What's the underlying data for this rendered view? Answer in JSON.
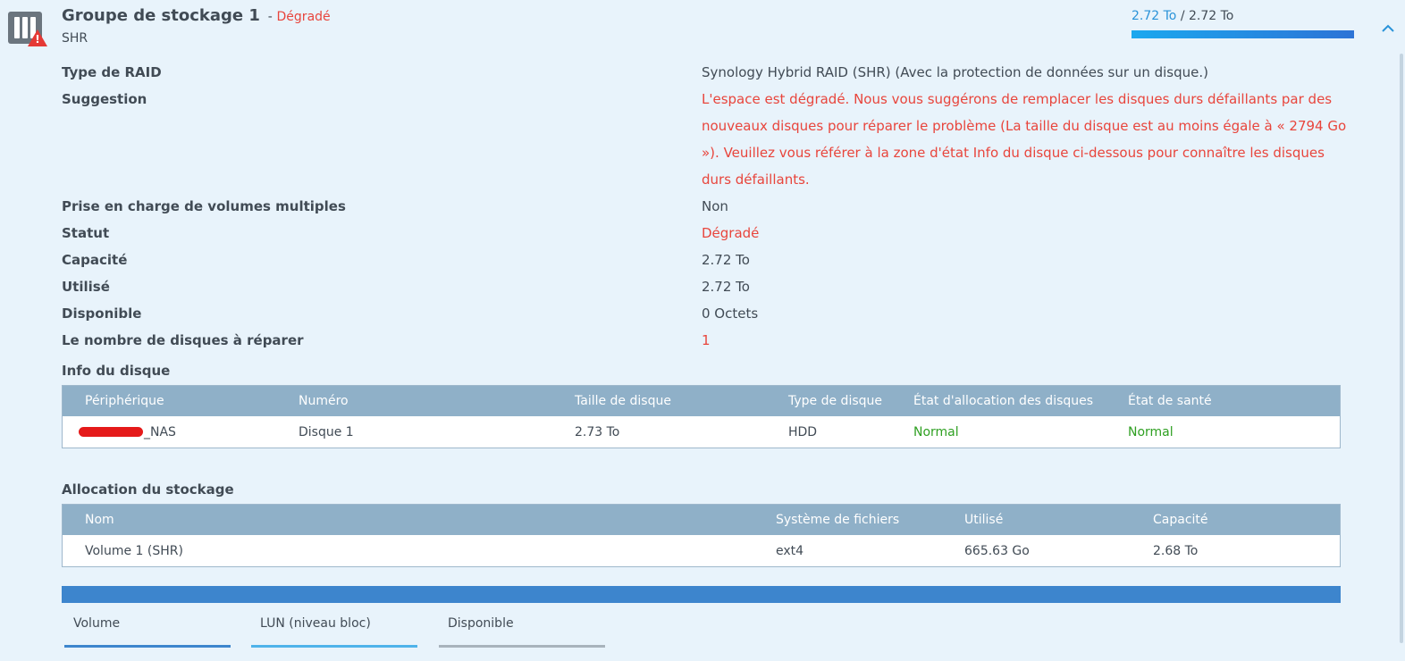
{
  "pool": {
    "title": "Groupe de stockage 1",
    "separator": "-",
    "status": "Dégradé",
    "subtitle": "SHR",
    "usage_used": "2.72 To",
    "usage_sep": " / ",
    "usage_total": "2.72 To",
    "usage_fraction": 1.0
  },
  "info": [
    {
      "label": "Type de RAID",
      "value": "Synology Hybrid RAID (SHR) (Avec la protection de données sur un disque.)",
      "red": false
    },
    {
      "label": "Suggestion",
      "value": "L'espace est dégradé. Nous vous suggérons de remplacer les disques durs défaillants par des nouveaux disques pour réparer le problème (La taille du disque est au moins égale à « 2794 Go »). Veuillez vous référer à la zone d'état Info du disque ci-dessous pour connaître les disques durs défaillants.",
      "red": true
    },
    {
      "label": "Prise en charge de volumes multiples",
      "value": "Non",
      "red": false
    },
    {
      "label": "Statut",
      "value": "Dégradé",
      "red": true
    },
    {
      "label": "Capacité",
      "value": "2.72 To",
      "red": false
    },
    {
      "label": "Utilisé",
      "value": "2.72 To",
      "red": false
    },
    {
      "label": "Disponible",
      "value": "0 Octets",
      "red": false
    },
    {
      "label": "Le nombre de disques à réparer",
      "value": "1",
      "red": true
    }
  ],
  "disk_info": {
    "title": "Info du disque",
    "columns": [
      "Périphérique",
      "Numéro",
      "Taille de disque",
      "Type de disque",
      "État d'allocation des disques",
      "État de santé"
    ],
    "rows": [
      {
        "device": "_NAS",
        "number": "Disque 1",
        "size": "2.73 To",
        "type": "HDD",
        "allocation": "Normal",
        "health": "Normal"
      }
    ]
  },
  "allocation": {
    "title": "Allocation du stockage",
    "columns": [
      "Nom",
      "Système de fichiers",
      "Utilisé",
      "Capacité"
    ],
    "rows": [
      {
        "name": "Volume 1 (SHR)",
        "fs": "ext4",
        "used": "665.63 Go",
        "capacity": "2.68 To"
      }
    ]
  },
  "legend": [
    {
      "label": "Volume",
      "color": "#3d85cd"
    },
    {
      "label": "LUN (niveau bloc)",
      "color": "#4fb3ea"
    },
    {
      "label": "Disponible",
      "color": "#a8b3bc"
    }
  ],
  "icons": {
    "pool": "storage-pool-icon",
    "warning": "warning-icon",
    "collapse": "chevron-up-icon"
  }
}
